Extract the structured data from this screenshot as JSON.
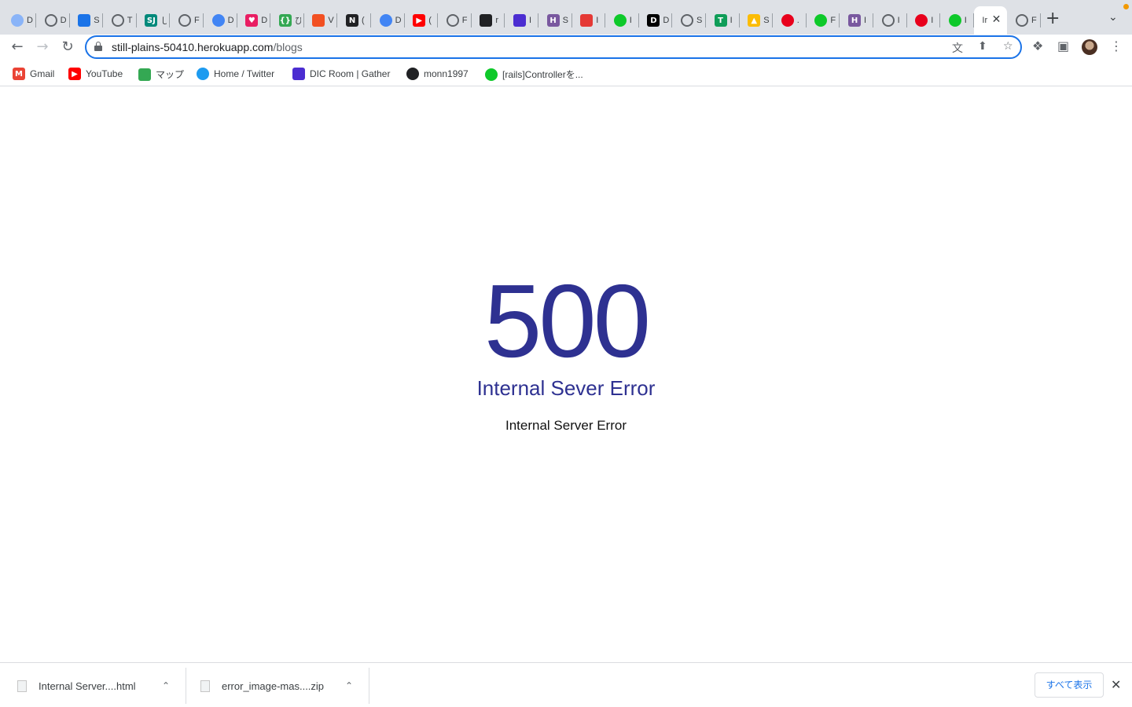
{
  "tabs": [
    {
      "icon": "shield-globe-icon",
      "color": "#8ab4f8",
      "glyph": "",
      "label": "D"
    },
    {
      "icon": "globe-icon",
      "color": "#5f6368",
      "glyph": "",
      "label": "D"
    },
    {
      "icon": "grid-squares-icon",
      "color": "#1a73e8",
      "glyph": "",
      "label": "S"
    },
    {
      "icon": "globe-icon",
      "color": "#5f6368",
      "glyph": "",
      "label": "T"
    },
    {
      "icon": "sb-logo-icon",
      "color": "#00897b",
      "glyph": "SJ",
      "label": "し"
    },
    {
      "icon": "globe-icon",
      "color": "#5f6368",
      "glyph": "",
      "label": "F"
    },
    {
      "icon": "gem-icon",
      "color": "#4285f4",
      "glyph": "",
      "label": "D"
    },
    {
      "icon": "heart-icon",
      "color": "#e91e63",
      "glyph": "♥",
      "label": "D"
    },
    {
      "icon": "braces-icon",
      "color": "#34a853",
      "glyph": "{}",
      "label": "ひ"
    },
    {
      "icon": "windows-icon",
      "color": "#f25022",
      "glyph": "",
      "label": "V"
    },
    {
      "icon": "notion-icon",
      "color": "#202124",
      "glyph": "N",
      "label": "("
    },
    {
      "icon": "gem-icon",
      "color": "#4285f4",
      "glyph": "",
      "label": "D"
    },
    {
      "icon": "youtube-icon",
      "color": "#ff0000",
      "glyph": "▶",
      "label": "("
    },
    {
      "icon": "globe-icon",
      "color": "#5f6368",
      "glyph": "",
      "label": "F"
    },
    {
      "icon": "github-icon",
      "color": "#202124",
      "glyph": "",
      "label": "r"
    },
    {
      "icon": "gather-icon",
      "color": "#4b2dd1",
      "glyph": "",
      "label": "I"
    },
    {
      "icon": "heroku-icon",
      "color": "#79589f",
      "glyph": "H",
      "label": "S"
    },
    {
      "icon": "house-icon",
      "color": "#e53935",
      "glyph": "",
      "label": "I"
    },
    {
      "icon": "qiita-icon",
      "color": "#0ec92a",
      "glyph": "",
      "label": "I"
    },
    {
      "icon": "dic-icon",
      "color": "#000000",
      "glyph": "D",
      "label": "D"
    },
    {
      "icon": "globe-icon",
      "color": "#5f6368",
      "glyph": "",
      "label": "S"
    },
    {
      "icon": "sheets-icon",
      "color": "#0f9d58",
      "glyph": "T",
      "label": "I"
    },
    {
      "icon": "drive-icon",
      "color": "#fbbc04",
      "glyph": "▲",
      "label": "S"
    },
    {
      "icon": "red-circle-icon",
      "color": "#e8001c",
      "glyph": "",
      "label": "."
    },
    {
      "icon": "qiita-icon",
      "color": "#0ec92a",
      "glyph": "",
      "label": "F"
    },
    {
      "icon": "heroku-icon",
      "color": "#79589f",
      "glyph": "H",
      "label": "I"
    },
    {
      "icon": "globe-icon",
      "color": "#5f6368",
      "glyph": "",
      "label": "I"
    },
    {
      "icon": "red-logo-icon",
      "color": "#e8001c",
      "glyph": "",
      "label": "I"
    },
    {
      "icon": "qiita-icon",
      "color": "#0ec92a",
      "glyph": "",
      "label": "I"
    },
    {
      "icon": "",
      "color": "",
      "glyph": "",
      "label": "Ir",
      "active": true
    },
    {
      "icon": "globe-icon",
      "color": "#5f6368",
      "glyph": "",
      "label": "F"
    }
  ],
  "address": {
    "host": "still-plains-50410.herokuapp.com",
    "path": "/blogs"
  },
  "bookmarks": [
    {
      "label": "Gmail",
      "icon": "gmail-icon",
      "color": "#ea4335",
      "glyph": "M"
    },
    {
      "label": "YouTube",
      "icon": "youtube-icon",
      "color": "#ff0000",
      "glyph": "▶"
    },
    {
      "label": "マップ",
      "icon": "maps-icon",
      "color": "#34a853",
      "glyph": ""
    },
    {
      "label": "Home / Twitter",
      "icon": "twitter-icon",
      "color": "#1d9bf0",
      "glyph": ""
    },
    {
      "label": "DIC Room | Gather",
      "icon": "gather-icon",
      "color": "#4b2dd1",
      "glyph": ""
    },
    {
      "label": "monn1997",
      "icon": "github-icon",
      "color": "#202124",
      "glyph": ""
    },
    {
      "label": "[rails]Controllerを...",
      "icon": "qiita-icon",
      "color": "#0ec92a",
      "glyph": ""
    }
  ],
  "error": {
    "code": "500",
    "title": "Internal Sever Error",
    "message": "Internal Server Error"
  },
  "downloads": [
    {
      "name": "Internal Server....html"
    },
    {
      "name": "error_image-mas....zip"
    }
  ],
  "download_bar": {
    "show_all": "すべて表示"
  },
  "colors": {
    "error_accent": "#2e3191",
    "omnibox_focus": "#1a73e8"
  }
}
